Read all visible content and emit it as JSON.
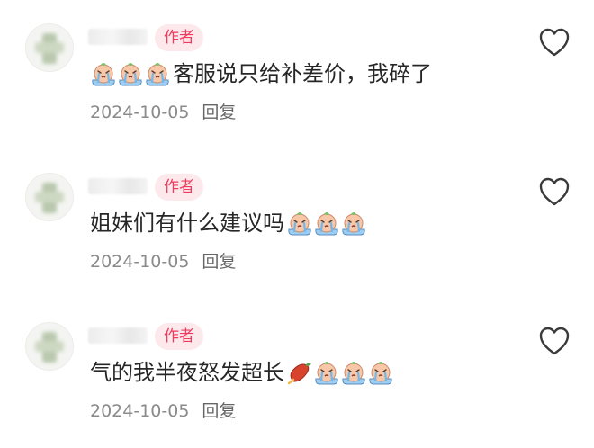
{
  "comments": [
    {
      "badge": "作者",
      "text": "客服说只给补差价，我碎了",
      "date": "2024-10-05",
      "reply": "回复",
      "emojis_before": [
        "crying-face-icon",
        "crying-face-icon",
        "crying-face-icon"
      ],
      "emojis_after": []
    },
    {
      "badge": "作者",
      "text": "姐妹们有什么建议吗",
      "date": "2024-10-05",
      "reply": "回复",
      "emojis_before": [],
      "emojis_after": [
        "crying-face-icon",
        "crying-face-icon",
        "crying-face-icon"
      ]
    },
    {
      "badge": "作者",
      "text": "气的我半夜怒发超长",
      "date": "2024-10-05",
      "reply": "回复",
      "emojis_before": [],
      "emojis_after": [
        "sweet-potato-icon",
        "crying-face-icon",
        "crying-face-icon",
        "crying-face-icon"
      ]
    }
  ],
  "colors": {
    "badge_text": "#ef3a5e",
    "badge_bg": "#fde8ec",
    "meta_text": "#8a8a8a",
    "heart_stroke": "#3a3a3a"
  }
}
